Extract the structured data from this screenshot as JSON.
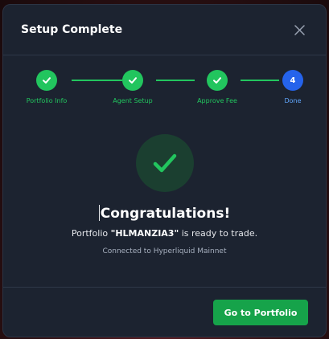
{
  "modal": {
    "title": "Setup Complete",
    "close_icon": "close-icon"
  },
  "stepper": {
    "steps": [
      {
        "label": "Portfolio Info",
        "status": "complete",
        "icon": "check-icon"
      },
      {
        "label": "Agent Setup",
        "status": "complete",
        "icon": "check-icon"
      },
      {
        "label": "Approve Fee",
        "status": "complete",
        "icon": "check-icon"
      },
      {
        "label": "Done",
        "status": "active",
        "number": "4"
      }
    ]
  },
  "result": {
    "icon": "large-check-icon",
    "heading": "Congratulations!",
    "message_prefix": "Portfolio ",
    "portfolio_name": "\"HLMANZIA3\"",
    "message_suffix": " is ready to trade.",
    "connection": "Connected to Hyperliquid Mainnet"
  },
  "footer": {
    "primary_button": "Go to Portfolio"
  },
  "colors": {
    "modal_bg": "#1c2330",
    "success": "#22c55e",
    "active_step": "#2563eb",
    "button": "#16a34a"
  }
}
